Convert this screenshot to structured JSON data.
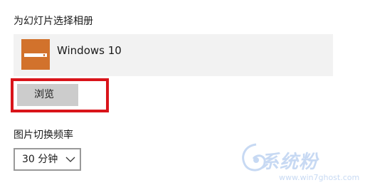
{
  "album_section": {
    "label": "为幻灯片选择相册",
    "album": {
      "name": "Windows 10",
      "thumbnail_icon": "album-folder-icon",
      "thumbnail_color": "#d2722c"
    },
    "browse_label": "浏览",
    "highlight_color": "#d9141a"
  },
  "interval_section": {
    "label": "图片切换频率",
    "selected": "30 分钟",
    "dropdown_icon": "chevron-down-icon"
  },
  "watermark": {
    "text": "系统粉",
    "url": "www.win7ghost.com"
  }
}
